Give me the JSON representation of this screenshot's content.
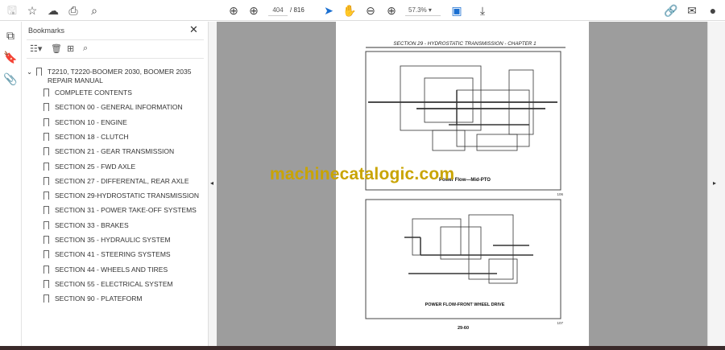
{
  "toolbar": {
    "page_current": "404",
    "page_total": "/ 816",
    "zoom": "57.3%"
  },
  "bookmarks": {
    "title": "Bookmarks",
    "root_line1": "T2210, T2220-BOOMER 2030, BOOMER 2035",
    "root_line2": "REPAIR MANUAL",
    "items": [
      "COMPLETE CONTENTS",
      "SECTION 00 - GENERAL INFORMATION",
      "SECTION 10 - ENGINE",
      "SECTION 18 - CLUTCH",
      "SECTION 21 - GEAR TRANSMISSION",
      "SECTION 25 - FWD AXLE",
      "SECTION 27 - DIFFERENTAL, REAR AXLE",
      "SECTION 29-HYDROSTATIC TRANSMISSION",
      "SECTION 31 - POWER TAKE-OFF SYSTEMS",
      "SECTION 33 - BRAKES",
      "SECTION 35 - HYDRAULIC SYSTEM",
      "SECTION 41 - STEERING SYSTEMS",
      "SECTION 44 - WHEELS AND TIRES",
      "SECTION 55 - ELECTRICAL SYSTEM",
      "SECTION 90 - PLATEFORM"
    ]
  },
  "document": {
    "header": "SECTION 29 - HYDROSTATIC TRANSMISSION - CHAPTER 1",
    "fig1_caption": "Power Flow—Mid-PTO",
    "fig1_num": "106",
    "fig2_caption": "POWER FLOW-FRONT WHEEL DRIVE",
    "fig2_num": "107",
    "page_number": "29-60",
    "watermark": "machinecatalogic.com"
  }
}
